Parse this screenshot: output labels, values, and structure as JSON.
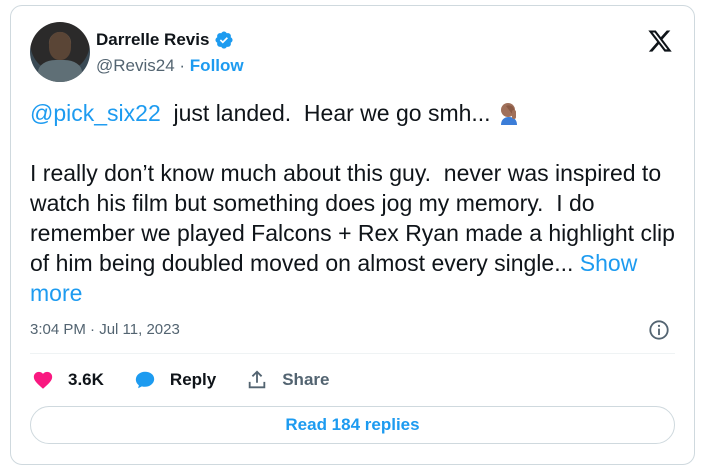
{
  "author": {
    "name": "Darrelle Revis",
    "handle": "@Revis24",
    "separator": " · ",
    "follow_label": "Follow"
  },
  "tweet": {
    "mention": "@pick_six22",
    "line1_rest": "  just landed.  Hear we go smh...",
    "paragraph2": "I really don’t know much about this guy.  never was inspired to watch his film but something does jog my memory.  I do remember we played Falcons + Rex Ryan made a highlight clip of him being doubled moved on almost every single...",
    "show_more": "Show more",
    "timestamp": "3:04 PM · Jul 11, 2023"
  },
  "actions": {
    "likes": "3.6K",
    "reply_label": "Reply",
    "share_label": "Share"
  },
  "read_replies_label": "Read 184 replies",
  "colors": {
    "accent": "#1d9bf0",
    "like": "#f91880",
    "text": "#0f1419",
    "muted": "#536471"
  },
  "icons": [
    "verified-badge-icon",
    "x-logo-icon",
    "facepalm-emoji-icon",
    "info-icon",
    "heart-icon",
    "reply-bubble-icon",
    "share-icon"
  ]
}
